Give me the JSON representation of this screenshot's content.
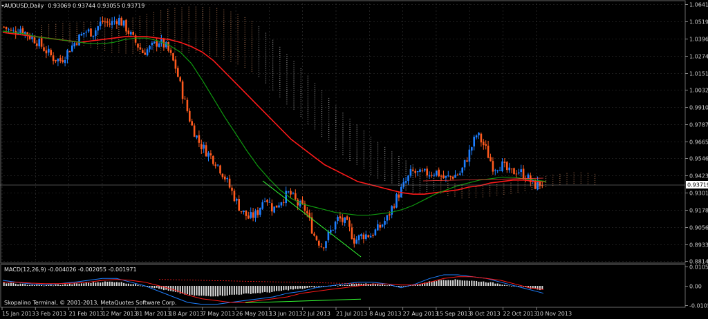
{
  "window": {
    "symbol": "AUDUSD,Daily",
    "ohlc": "0.93069 0.93744 0.93055 0.93719",
    "footer": "Skopalino Terminal, © 2001-2013, MetaQuotes Software Corp."
  },
  "colors": {
    "background": "#000000",
    "grid": "#3a3a3a",
    "bull": "#1e7fff",
    "bear": "#ff5a1e",
    "ma_red": "#ff1a1a",
    "ma_green": "#0f9a0f",
    "cloud_light": "#d9d9d9",
    "cloud_orange": "#f0a070",
    "macd_hist": "#d9d9d9",
    "macd_line": "#1e7fff",
    "signal_line": "#ff1a1a",
    "divergence_green": "#33ff33",
    "current_price_label": "#ffffff"
  },
  "chart_data": [
    {
      "type": "candlestick",
      "title": "AUDUSD,Daily",
      "ylim": [
        0.88145,
        1.06415
      ],
      "y_ticks": [
        "1.06415",
        "1.05190",
        "1.03965",
        "1.02740",
        "1.01515",
        "1.00325",
        "0.99100",
        "0.97875",
        "0.96650",
        "0.95460",
        "0.94235",
        "0.93010",
        "0.91785",
        "0.90560",
        "0.89335",
        "0.88145"
      ],
      "current_price": "0.93719",
      "x_ticks": [
        "15 Jan 2013",
        "3 Feb 2013",
        "21 Feb 2013",
        "12 Mar 2013",
        "31 Mar 2013",
        "18 Apr 2013",
        "7 May 2013",
        "26 May 2013",
        "13 Jun 2013",
        "2 Jul 2013",
        "21 Jul 2013",
        "8 Aug 2013",
        "27 Aug 2013",
        "15 Sep 2013",
        "3 Oct 2013",
        "22 Oct 2013",
        "10 Nov 2013"
      ],
      "close_path": [
        1.048,
        1.044,
        1.047,
        1.042,
        1.038,
        1.032,
        1.026,
        1.024,
        1.032,
        1.039,
        1.045,
        1.044,
        1.052,
        1.05,
        1.054,
        1.047,
        1.038,
        1.03,
        1.033,
        1.038,
        1.033,
        1.02,
        0.998,
        0.978,
        0.965,
        0.958,
        0.952,
        0.942,
        0.93,
        0.918,
        0.912,
        0.915,
        0.928,
        0.918,
        0.925,
        0.93,
        0.922,
        0.918,
        0.9,
        0.892,
        0.902,
        0.912,
        0.908,
        0.896,
        0.9,
        0.9,
        0.905,
        0.912,
        0.925,
        0.935,
        0.945,
        0.943,
        0.944,
        0.945,
        0.94,
        0.942,
        0.944,
        0.958,
        0.972,
        0.962,
        0.948,
        0.95,
        0.944,
        0.946,
        0.942,
        0.935,
        0.937
      ],
      "series": [
        {
          "name": "",
          "color_key": "ma_red",
          "values": [
            1.044,
            1.043,
            1.042,
            1.041,
            1.04,
            1.039,
            1.038,
            1.037,
            1.038,
            1.039,
            1.04,
            1.041,
            1.041,
            1.041,
            1.04,
            1.039,
            1.037,
            1.034,
            1.03,
            1.024,
            1.016,
            1.008,
            1.0,
            0.992,
            0.984,
            0.976,
            0.968,
            0.962,
            0.956,
            0.95,
            0.946,
            0.942,
            0.938,
            0.936,
            0.934,
            0.932,
            0.93,
            0.929,
            0.929,
            0.93,
            0.931,
            0.932,
            0.934,
            0.935,
            0.937,
            0.938,
            0.939,
            0.939,
            0.938,
            0.938
          ]
        },
        {
          "name": "",
          "color_key": "ma_green",
          "values": [
            1.045,
            1.044,
            1.043,
            1.041,
            1.04,
            1.039,
            1.038,
            1.037,
            1.036,
            1.036,
            1.037,
            1.039,
            1.04,
            1.04,
            1.038,
            1.035,
            1.03,
            1.022,
            1.01,
            0.997,
            0.984,
            0.972,
            0.96,
            0.949,
            0.94,
            0.932,
            0.926,
            0.922,
            0.92,
            0.918,
            0.916,
            0.915,
            0.914,
            0.914,
            0.915,
            0.916,
            0.918,
            0.921,
            0.925,
            0.929,
            0.932,
            0.935,
            0.937,
            0.939,
            0.94,
            0.941,
            0.941,
            0.94,
            0.939,
            0.938
          ]
        }
      ]
    },
    {
      "type": "bar",
      "title": "MACD(12,26,9) -0.004026 -0.002055 -0.001971",
      "ylim": [
        -0.0105,
        0.0105
      ],
      "y_ticks": [
        "0.010535",
        "0.00",
        "-0.0105"
      ],
      "series": [
        {
          "name": "MACD(12,26,9)",
          "color_key": "macd_line",
          "values": [
            0.003,
            0.002,
            0.001,
            0.0005,
            0.0012,
            0.002,
            0.003,
            0.004,
            0.004,
            0.002,
            0.0,
            -0.003,
            -0.006,
            -0.009,
            -0.01,
            -0.01,
            -0.009,
            -0.008,
            -0.007,
            -0.006,
            -0.004,
            -0.003,
            -0.001,
            0.0,
            0.001,
            0.002,
            0.002,
            0.001,
            -0.001,
            0.001,
            0.004,
            0.006,
            0.006,
            0.005,
            0.004,
            0.002,
            0.0,
            -0.002,
            -0.004
          ]
        },
        {
          "name": "",
          "color_key": "signal_line",
          "values": [
            0.002,
            0.002,
            0.0015,
            0.0012,
            0.0012,
            0.0015,
            0.002,
            0.003,
            0.0035,
            0.003,
            0.002,
            0.0,
            -0.002,
            -0.005,
            -0.007,
            -0.008,
            -0.009,
            -0.009,
            -0.008,
            -0.007,
            -0.006,
            -0.004,
            -0.003,
            -0.002,
            -0.001,
            0.0,
            0.001,
            0.001,
            0.0005,
            0.0005,
            0.002,
            0.004,
            0.005,
            0.005,
            0.004,
            0.003,
            0.001,
            -0.001,
            -0.002
          ]
        }
      ]
    }
  ]
}
